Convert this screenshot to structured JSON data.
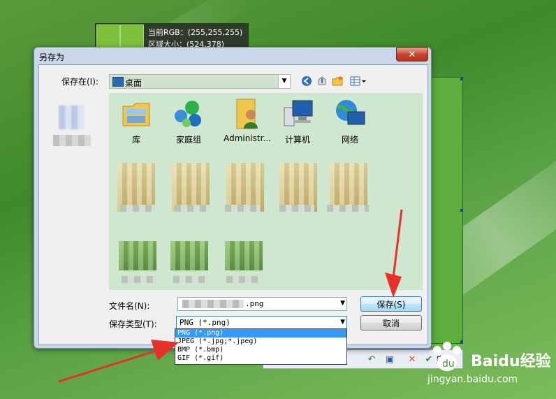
{
  "rgb_panel": {
    "line1": "当前RGB：(255,255,255)",
    "line2": "区域大小：(524,378)"
  },
  "dialog": {
    "title": "另存为",
    "close_glyph": "✕",
    "save_in_label": "保存在(I):",
    "location_value": "桌面",
    "items": [
      {
        "name": "库",
        "icon": "library-icon"
      },
      {
        "name": "家庭组",
        "icon": "homegroup-icon"
      },
      {
        "name": "Administr...",
        "icon": "user-folder-icon"
      },
      {
        "name": "计算机",
        "icon": "computer-icon"
      },
      {
        "name": "网络",
        "icon": "network-icon"
      }
    ],
    "filename_label": "文件名(N):",
    "filename_ext": ".png",
    "filetype_label": "保存类型(T):",
    "filetype_value": "PNG (*.png)",
    "save_button": "保存(S)",
    "cancel_button": "取消",
    "type_options": [
      "PNG (*.png)",
      "JPEG (*.jpg;*.jpeg)",
      "BMP (*.bmp)",
      "GIF (*.gif)"
    ]
  },
  "toolbar": {
    "finish_label": "完成"
  },
  "watermark": {
    "brand": "Baidu经验",
    "url": "jingyan.baidu.com"
  },
  "colors": {
    "accent": "#3c7fb1",
    "selection": "#3399ff",
    "arrow": "#e8302a",
    "close": "#c5442f"
  }
}
